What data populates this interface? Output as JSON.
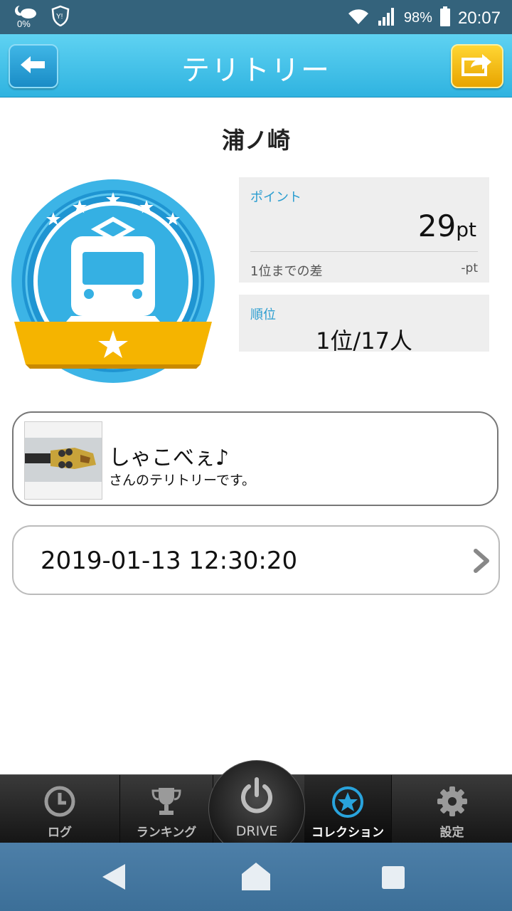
{
  "status_bar": {
    "weather_percent": "0%",
    "battery_percent": "98%",
    "time": "20:07"
  },
  "header": {
    "title": "テリトリー",
    "back_icon": "arrow-left-icon",
    "share_icon": "share-icon"
  },
  "station": {
    "name": "浦ノ崎"
  },
  "points": {
    "label": "ポイント",
    "value": "29",
    "unit": "pt",
    "diff_label": "1位までの差",
    "diff_value": "-pt"
  },
  "rank": {
    "label": "順位",
    "value": "1位/17人"
  },
  "owner": {
    "name": "しゃこべぇ♪",
    "description": "さんのテリトリーです。"
  },
  "date": {
    "value": "2019-01-13 12:30:20"
  },
  "tabs": [
    {
      "label": "ログ",
      "icon": "clock-icon"
    },
    {
      "label": "ランキング",
      "icon": "trophy-icon"
    },
    {
      "label": "DRIVE",
      "icon": "power-icon"
    },
    {
      "label": "コレクション",
      "icon": "star-circle-icon",
      "active": true
    },
    {
      "label": "設定",
      "icon": "gear-icon"
    }
  ],
  "colors": {
    "header": "#2fb3e0",
    "accent_label": "#2a9dd0",
    "badge_blue": "#29a3dc",
    "ribbon_gold": "#f5b400",
    "share_button": "#f0b400"
  }
}
